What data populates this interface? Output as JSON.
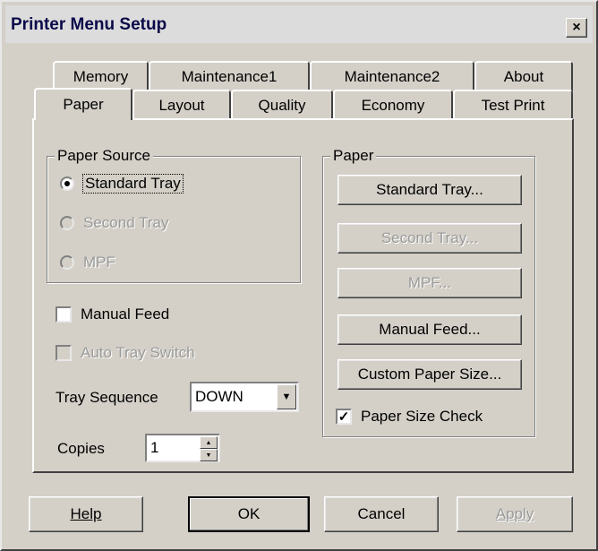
{
  "window": {
    "title": "Printer Menu Setup",
    "close_glyph": "×"
  },
  "tabs": {
    "row_back": [
      "Memory",
      "Maintenance1",
      "Maintenance2",
      "About"
    ],
    "row_front": [
      "Paper",
      "Layout",
      "Quality",
      "Economy",
      "Test Print"
    ],
    "selected": "Paper"
  },
  "paper_source": {
    "legend": "Paper Source",
    "options": [
      {
        "label": "Standard Tray",
        "selected": true,
        "enabled": true
      },
      {
        "label": "Second Tray",
        "selected": false,
        "enabled": false
      },
      {
        "label": "MPF",
        "selected": false,
        "enabled": false
      }
    ]
  },
  "manual_feed": {
    "label": "Manual Feed",
    "checked": false,
    "enabled": true
  },
  "auto_tray_switch": {
    "label": "Auto Tray Switch",
    "checked": false,
    "enabled": false
  },
  "tray_sequence": {
    "label": "Tray Sequence",
    "value": "DOWN"
  },
  "copies": {
    "label": "Copies",
    "value": "1"
  },
  "paper_group": {
    "legend": "Paper",
    "buttons": [
      {
        "label": "Standard Tray...",
        "enabled": true
      },
      {
        "label": "Second Tray...",
        "enabled": false
      },
      {
        "label": "MPF...",
        "enabled": false
      },
      {
        "label": "Manual Feed...",
        "enabled": true
      },
      {
        "label": "Custom Paper Size...",
        "enabled": true
      }
    ],
    "size_check": {
      "label": "Paper Size Check",
      "checked": true
    }
  },
  "footer": {
    "help": "Help",
    "ok": "OK",
    "cancel": "Cancel",
    "apply": "Apply"
  },
  "icons": {
    "check_glyph": "✓",
    "dropdown_glyph": "▼",
    "spin_up_glyph": "▲",
    "spin_down_glyph": "▼"
  }
}
